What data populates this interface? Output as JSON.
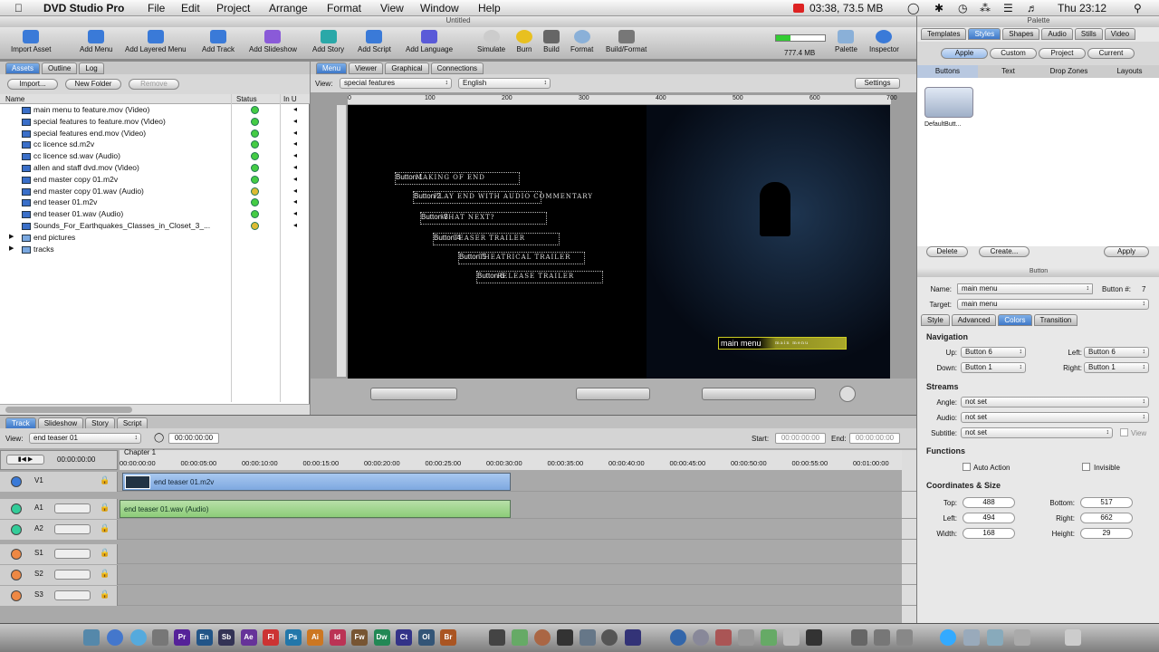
{
  "menubar": {
    "app": "DVD Studio Pro",
    "items": [
      "File",
      "Edit",
      "Project",
      "Arrange",
      "Format",
      "View",
      "Window",
      "Help"
    ],
    "status_time": "03:38, 73.5 MB",
    "clock": "Thu 23:12"
  },
  "window": {
    "title": "Untitled",
    "palette_title": "Palette",
    "inspector_title": "Button"
  },
  "toolbar": {
    "buttons": [
      "Import Asset",
      "Add Menu",
      "Add Layered Menu",
      "Add Track",
      "Add Slideshow",
      "Add Story",
      "Add Script",
      "Add Language",
      "Simulate",
      "Burn",
      "Build",
      "Format",
      "Build/Format"
    ],
    "disk": "777.4 MB",
    "palette": "Palette",
    "inspector": "Inspector"
  },
  "assets": {
    "tabs": [
      "Assets",
      "Outline",
      "Log"
    ],
    "import": "Import...",
    "new_folder": "New Folder",
    "remove": "Remove",
    "col_name": "Name",
    "col_status": "Status",
    "col_in": "In U",
    "rows": [
      {
        "name": "main menu to feature.mov (Video)",
        "status": "green"
      },
      {
        "name": "special features to feature.mov (Video)",
        "status": "green"
      },
      {
        "name": "special features end.mov (Video)",
        "status": "green"
      },
      {
        "name": "cc licence sd.m2v",
        "status": "green"
      },
      {
        "name": "cc licence sd.wav (Audio)",
        "status": "green"
      },
      {
        "name": "allen and staff dvd.mov (Video)",
        "status": "green"
      },
      {
        "name": "end master copy 01.m2v",
        "status": "green"
      },
      {
        "name": "end master copy 01.wav (Audio)",
        "status": "yellow"
      },
      {
        "name": "end teaser 01.m2v",
        "status": "green"
      },
      {
        "name": "end teaser 01.wav (Audio)",
        "status": "green"
      },
      {
        "name": "Sounds_For_Earthquakes_Classes_in_Closet_3_...",
        "status": "yellow"
      },
      {
        "name": "end pictures",
        "status": ""
      },
      {
        "name": "tracks",
        "status": ""
      }
    ]
  },
  "viewer": {
    "tabs": [
      "Menu",
      "Viewer",
      "Graphical",
      "Connections"
    ],
    "view_label": "View:",
    "view_value": "special features",
    "lang_value": "English",
    "settings": "Settings",
    "ruler": [
      "0",
      "100",
      "200",
      "300",
      "400",
      "500",
      "600",
      "700"
    ],
    "buttons": [
      {
        "label": "Button 1",
        "text": "Making of End"
      },
      {
        "label": "Button 2",
        "text": "Play End with Audio Commentary"
      },
      {
        "label": "Button 3",
        "text": "What Next?"
      },
      {
        "label": "Button 4",
        "text": "Teaser Trailer"
      },
      {
        "label": "Button 5",
        "text": "Theatrical Trailer"
      },
      {
        "label": "Button 6",
        "text": "Release Trailer"
      },
      {
        "label": "main menu",
        "text": "main menu"
      }
    ]
  },
  "timeline": {
    "tabs": [
      "Track",
      "Slideshow",
      "Story",
      "Script"
    ],
    "view_label": "View:",
    "view_value": "end teaser 01",
    "timecode": "00:00:00:00",
    "tc2": "00:00:00:00",
    "start_label": "Start:",
    "start_val": "00:00:00:00",
    "end_label": "End:",
    "end_val": "00:00:00:00",
    "chapter": "Chapter 1",
    "ticks": [
      "00:00:00:00",
      "00:00:05:00",
      "00:00:10:00",
      "00:00:15:00",
      "00:00:20:00",
      "00:00:25:00",
      "00:00:30:00",
      "00:00:35:00",
      "00:00:40:00",
      "00:00:45:00",
      "00:00:50:00",
      "00:00:55:00",
      "00:01:00:00"
    ],
    "tracks": [
      "V1",
      "A1",
      "A2",
      "S1",
      "S2",
      "S3"
    ],
    "video_clip": "end teaser 01.m2v",
    "audio_clip": "end teaser 01.wav (Audio)"
  },
  "palette": {
    "tabs": [
      "Templates",
      "Styles",
      "Shapes",
      "Audio",
      "Stills",
      "Video"
    ],
    "subtabs": [
      "Apple",
      "Custom",
      "Project",
      "Current"
    ],
    "kinds": [
      "Buttons",
      "Text",
      "Drop Zones",
      "Layouts"
    ],
    "item": "DefaultButt...",
    "delete": "Delete",
    "create": "Create...",
    "apply": "Apply"
  },
  "inspector": {
    "name_label": "Name:",
    "name": "main menu",
    "button_num_label": "Button #:",
    "button_num": "7",
    "target_label": "Target:",
    "target": "main menu",
    "tabs": [
      "Style",
      "Advanced",
      "Colors",
      "Transition"
    ],
    "nav_title": "Navigation",
    "up_label": "Up:",
    "up": "Button 6",
    "left_label": "Left:",
    "left": "Button 6",
    "down_label": "Down:",
    "down": "Button 1",
    "right_label": "Right:",
    "right": "Button 1",
    "streams_title": "Streams",
    "angle_label": "Angle:",
    "audio_label": "Audio:",
    "subtitle_label": "Subtitle:",
    "not_set": "not set",
    "view_label": "View",
    "functions_title": "Functions",
    "auto_action": "Auto Action",
    "invisible": "Invisible",
    "coords_title": "Coordinates & Size",
    "top_label": "Top:",
    "top": "488",
    "bottom_label": "Bottom:",
    "bottom": "517",
    "cleft_label": "Left:",
    "cleft": "494",
    "cright_label": "Right:",
    "cright": "662",
    "width_label": "Width:",
    "width": "168",
    "height_label": "Height:",
    "height": "29"
  },
  "dock": [
    "Pr",
    "En",
    "Sb",
    "Ae",
    "Fl",
    "Ps",
    "Ai",
    "Id",
    "Fw",
    "Dw",
    "Ct",
    "Ol",
    "Br"
  ]
}
